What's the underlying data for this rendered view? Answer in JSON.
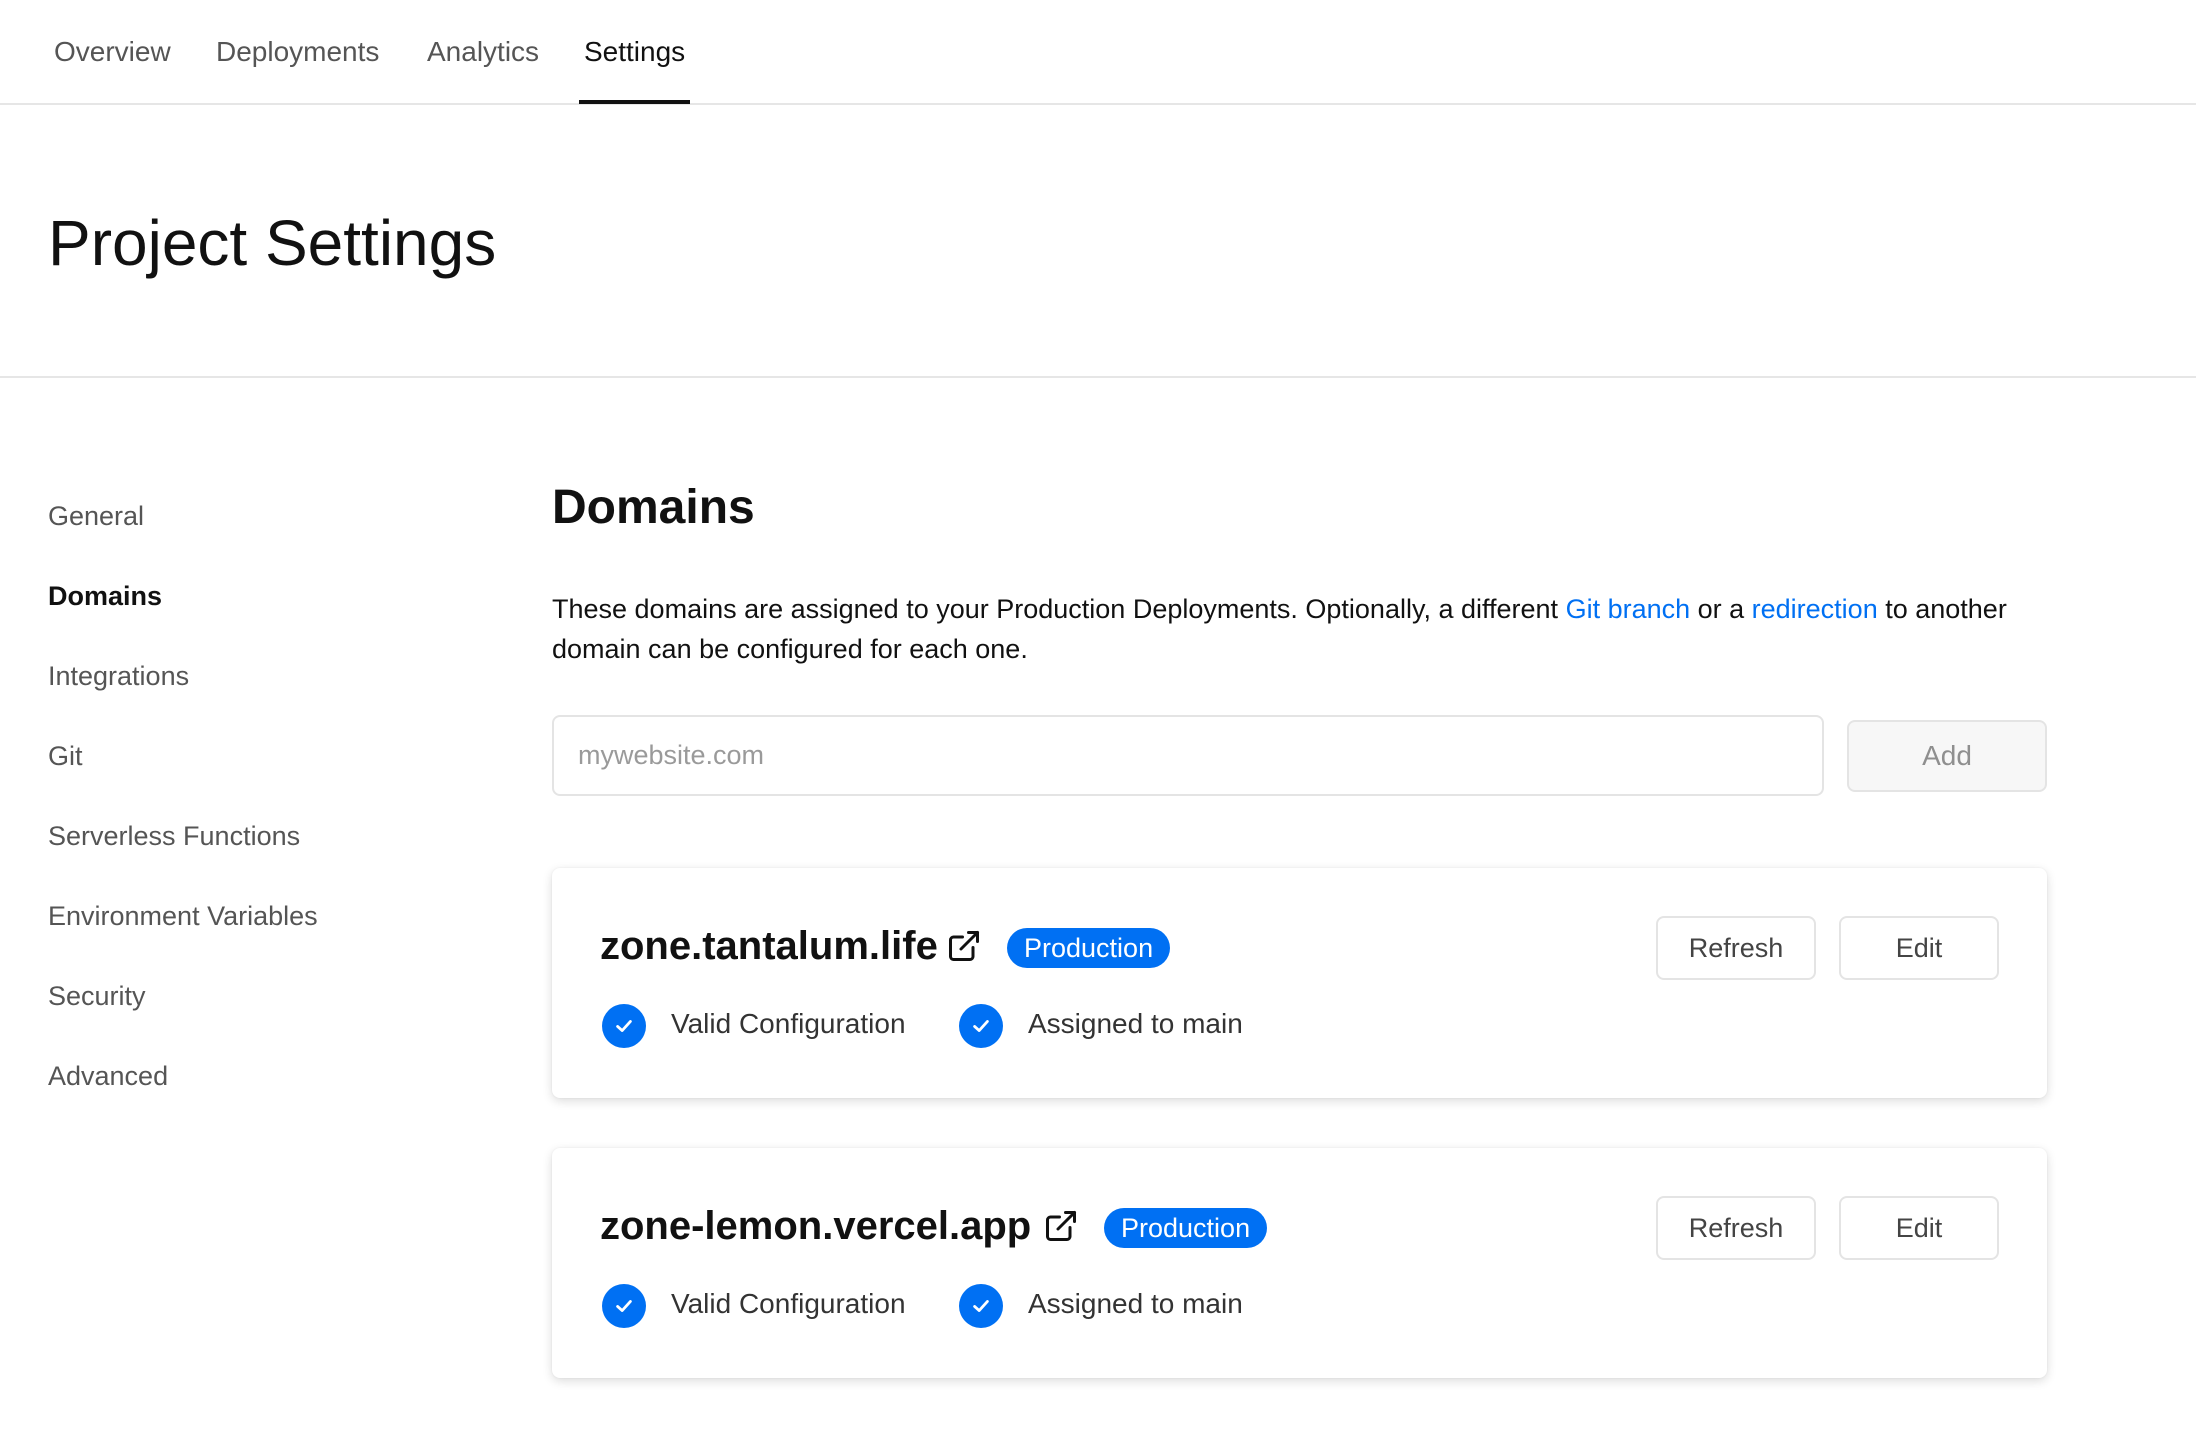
{
  "nav": {
    "tabs": [
      {
        "label": "Overview"
      },
      {
        "label": "Deployments"
      },
      {
        "label": "Analytics"
      },
      {
        "label": "Settings"
      }
    ],
    "active_tab": "Settings"
  },
  "page": {
    "title": "Project Settings"
  },
  "sidebar": {
    "items": [
      {
        "label": "General"
      },
      {
        "label": "Domains"
      },
      {
        "label": "Integrations"
      },
      {
        "label": "Git"
      },
      {
        "label": "Serverless Functions"
      },
      {
        "label": "Environment Variables"
      },
      {
        "label": "Security"
      },
      {
        "label": "Advanced"
      }
    ],
    "active_item": "Domains"
  },
  "domains": {
    "title": "Domains",
    "description": {
      "part1": "These domains are assigned to your Production Deployments. Optionally, a different ",
      "link1": "Git branch",
      "part2": " or a ",
      "link2": "redirection",
      "part3": " to another domain can be configured for each one."
    },
    "input_placeholder": "mywebsite.com",
    "input_value": "",
    "add_label": "Add",
    "items": [
      {
        "name": "zone.tantalum.life",
        "badge": "Production",
        "refresh_label": "Refresh",
        "edit_label": "Edit",
        "status1": "Valid Configuration",
        "status2": "Assigned to main"
      },
      {
        "name": "zone-lemon.vercel.app",
        "badge": "Production",
        "refresh_label": "Refresh",
        "edit_label": "Edit",
        "status1": "Valid Configuration",
        "status2": "Assigned to main"
      }
    ]
  },
  "colors": {
    "accent": "#0070f3",
    "text": "#111111",
    "muted": "#555555",
    "border": "#e4e4e4"
  },
  "icons": [
    "external-link-icon",
    "checkmark-icon"
  ]
}
